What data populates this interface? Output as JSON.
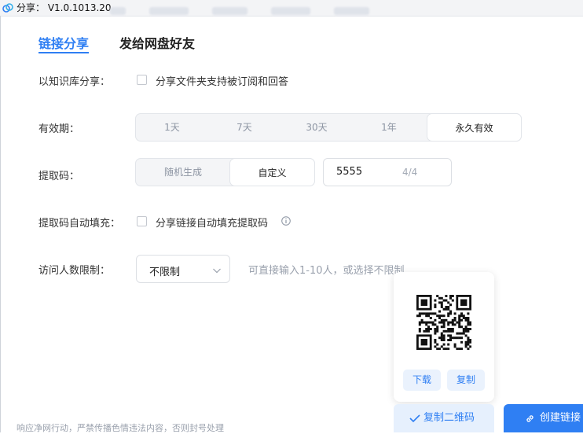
{
  "window": {
    "title": "分享： V1.0.1013.20"
  },
  "tabs": [
    {
      "label": "链接分享",
      "active": true
    },
    {
      "label": "发给网盘好友",
      "active": false
    }
  ],
  "kb_share": {
    "label": "以知识库分享：",
    "checkbox_label": "分享文件夹支持被订阅和回答",
    "checked": false
  },
  "validity": {
    "label": "有效期：",
    "options": [
      "1天",
      "7天",
      "30天",
      "1年",
      "永久有效"
    ],
    "selected": "永久有效"
  },
  "extract_code": {
    "label": "提取码：",
    "options": [
      "随机生成",
      "自定义"
    ],
    "selected": "自定义",
    "value": "5555",
    "count": "4/4"
  },
  "autofill": {
    "label": "提取码自动填充：",
    "checkbox_label": "分享链接自动填充提取码",
    "checked": false
  },
  "visitor_limit": {
    "label": "访问人数限制：",
    "selected": "不限制",
    "hint": "可直接输入1-10人，或选择不限制"
  },
  "qr_popup": {
    "download_label": "下载",
    "copy_label": "复制"
  },
  "footer": {
    "notice": "响应净网行动，严禁传播色情违法内容，否则封号处理"
  },
  "actions": {
    "copy_qr_label": "复制二维码",
    "create_link_label": "创建链接"
  },
  "colors": {
    "accent": "#2f7ff3",
    "accent_light": "#e6f0fd",
    "muted": "#9aa1ad"
  }
}
